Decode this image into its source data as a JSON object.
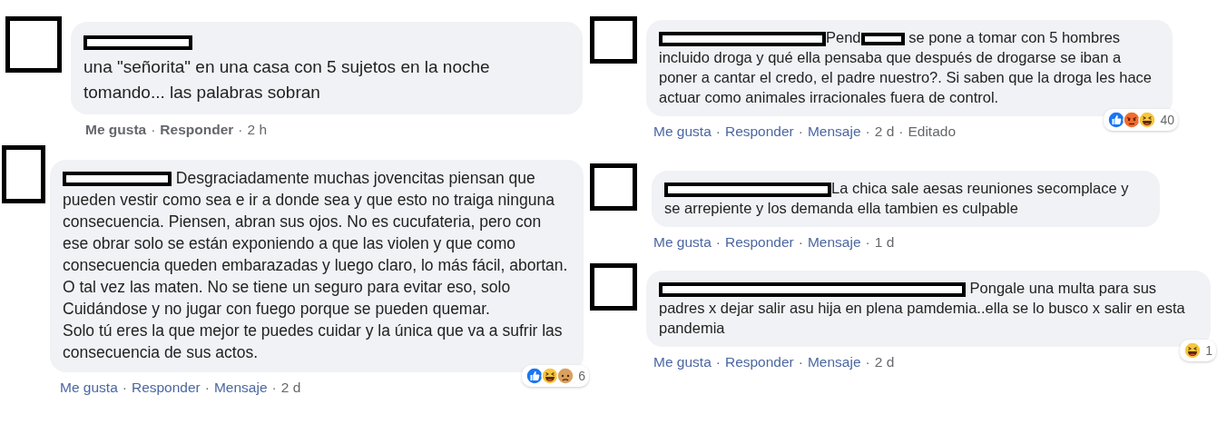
{
  "columns": [
    {
      "comments": [
        {
          "parts": [
            {
              "kind": "redaction"
            },
            {
              "kind": "break"
            },
            {
              "kind": "text",
              "text": "una \"señorita\" en una casa con 5 sujetos en la noche tomando... las palabras sobran"
            }
          ],
          "actions": [
            "Me gusta",
            "Responder"
          ],
          "separator": "·",
          "time": "2 h"
        },
        {
          "parts": [
            {
              "kind": "redaction"
            },
            {
              "kind": "text",
              "text": " Desgraciadamente muchas jovencitas piensan que pueden vestir como sea e ir a donde sea y que esto no traiga ninguna consecuencia. Piensen, abran sus ojos. No es cucufateria, pero con ese obrar solo se están exponiendo a que las violen y que como consecuencia queden embarazadas y luego claro, lo más fácil, abortan. O tal vez las maten. No se tiene un seguro para evitar eso, solo Cuidándose y no jugar con fuego porque se pueden quemar.\nSolo tú eres la que mejor te puedes cuidar y la única que va a sufrir las consecuencia de sus actos."
            }
          ],
          "actions": [
            "Me gusta",
            "Responder",
            "Mensaje"
          ],
          "separator": "·",
          "time": "2 d",
          "reactions": [
            {
              "kind": "like"
            },
            {
              "kind": "haha"
            },
            {
              "kind": "sad"
            }
          ],
          "reaction_count": "6"
        }
      ]
    },
    {
      "comments": [
        {
          "parts": [
            {
              "kind": "redaction"
            },
            {
              "kind": "text",
              "text": "Pend"
            },
            {
              "kind": "redaction-small"
            },
            {
              "kind": "text",
              "text": " se pone a tomar con 5 hombres incluido droga y qué ella pensaba que después de drogarse se iban a poner a cantar el credo, el padre nuestro?. Si saben que la droga les hace actuar como animales irracionales fuera de control."
            }
          ],
          "actions": [
            "Me gusta",
            "Responder",
            "Mensaje"
          ],
          "separator": "·",
          "time": "2 d",
          "edited": "Editado",
          "reactions": [
            {
              "kind": "like"
            },
            {
              "kind": "angry"
            },
            {
              "kind": "haha"
            }
          ],
          "reaction_count": "40"
        },
        {
          "parts": [
            {
              "kind": "redaction"
            },
            {
              "kind": "text",
              "text": "La chica sale aesas reuniones secomplace y se arrepiente y los demanda ella tambien es culpable"
            }
          ],
          "actions": [
            "Me gusta",
            "Responder",
            "Mensaje"
          ],
          "separator": "·",
          "time": "1 d"
        },
        {
          "parts": [
            {
              "kind": "redaction-long"
            },
            {
              "kind": "text",
              "text": " Pongale una multa para sus padres x dejar salir asu hija en plena pamdemia..ella se lo busco x salir en esta pandemia"
            }
          ],
          "actions": [
            "Me gusta",
            "Responder",
            "Mensaje"
          ],
          "separator": "·",
          "time": "2 d",
          "reactions": [
            {
              "kind": "haha"
            }
          ],
          "reaction_count": "1"
        }
      ]
    }
  ]
}
